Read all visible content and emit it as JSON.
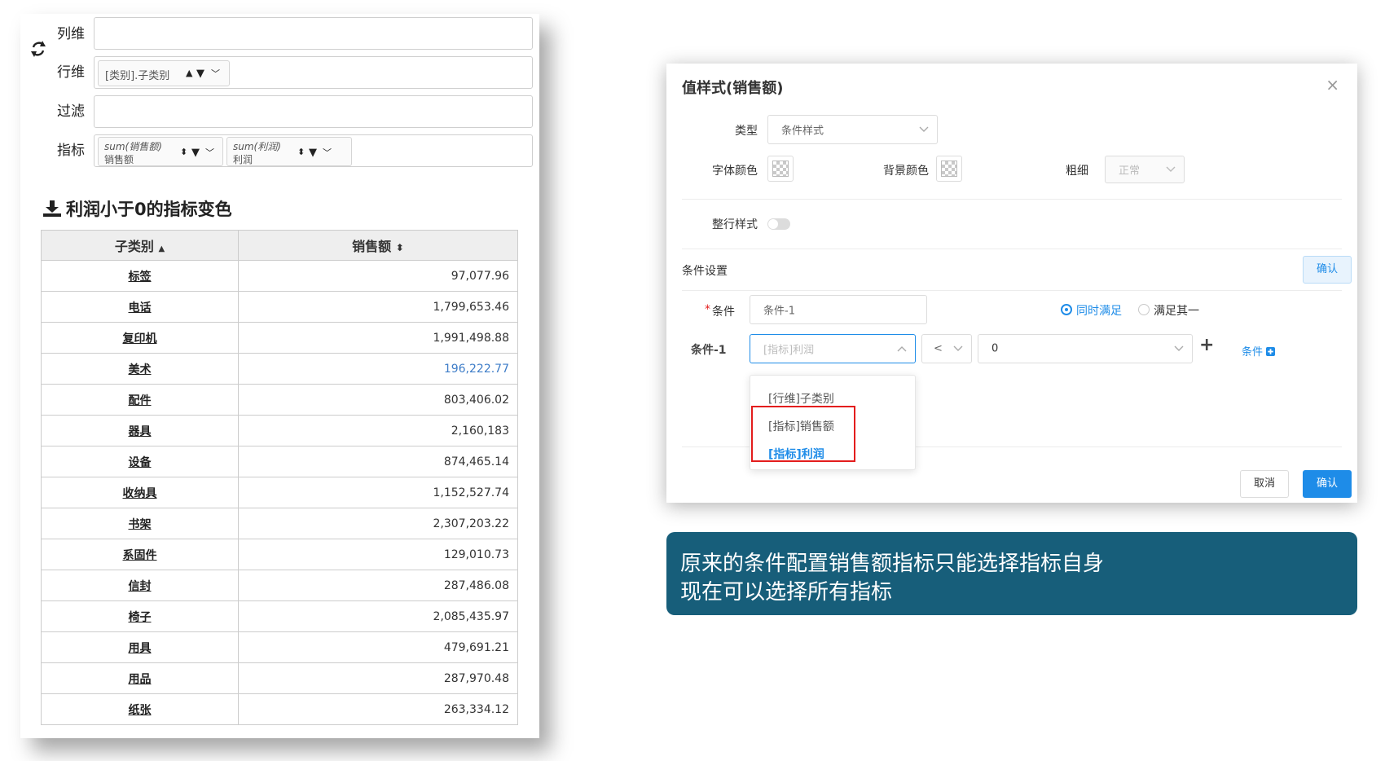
{
  "left_panel": {
    "dims": [
      {
        "label": "列维"
      },
      {
        "label": "行维",
        "tag": "[类别].子类别"
      },
      {
        "label": "过滤"
      },
      {
        "label": "指标",
        "metrics": [
          {
            "expr": "sum(销售额)",
            "name": "销售额"
          },
          {
            "expr": "sum(利润)",
            "name": "利润"
          }
        ]
      }
    ],
    "section_title": "利润小于0的指标变色",
    "table": {
      "headers": [
        "子类别",
        "销售额"
      ],
      "rows": [
        {
          "cat": "标签",
          "val": "97,077.96",
          "neg": false
        },
        {
          "cat": "电话",
          "val": "1,799,653.46",
          "neg": false
        },
        {
          "cat": "复印机",
          "val": "1,991,498.88",
          "neg": false
        },
        {
          "cat": "美术",
          "val": "196,222.77",
          "neg": true
        },
        {
          "cat": "配件",
          "val": "803,406.02",
          "neg": false
        },
        {
          "cat": "器具",
          "val": "2,160,183",
          "neg": false
        },
        {
          "cat": "设备",
          "val": "874,465.14",
          "neg": false
        },
        {
          "cat": "收纳具",
          "val": "1,152,527.74",
          "neg": false
        },
        {
          "cat": "书架",
          "val": "2,307,203.22",
          "neg": false
        },
        {
          "cat": "系固件",
          "val": "129,010.73",
          "neg": false
        },
        {
          "cat": "信封",
          "val": "287,486.08",
          "neg": false
        },
        {
          "cat": "椅子",
          "val": "2,085,435.97",
          "neg": false
        },
        {
          "cat": "用具",
          "val": "479,691.21",
          "neg": false
        },
        {
          "cat": "用品",
          "val": "287,970.48",
          "neg": false
        },
        {
          "cat": "纸张",
          "val": "263,334.12",
          "neg": false
        }
      ]
    }
  },
  "dialog": {
    "title": "值样式(销售额)",
    "close": "×",
    "type_label": "类型",
    "type_value": "条件样式",
    "font_color_label": "字体颜色",
    "bg_color_label": "背景颜色",
    "weight_label": "粗细",
    "weight_value": "正常",
    "row_style_label": "整行样式",
    "cond_settings_label": "条件设置",
    "cond_settings_confirm": "确认",
    "cond_required": "*",
    "cond_label": "条件",
    "cond_value": "条件-1",
    "radio_all": "同时满足",
    "radio_any": "满足其一",
    "cond1_label": "条件-1",
    "cond1_field_placeholder": "[指标]利润",
    "cond1_operator": "<",
    "cond1_value": "0",
    "add_plus": "+",
    "add_cond_link": "条件",
    "dropdown_options": [
      {
        "label": "[行维]子类别",
        "selected": false
      },
      {
        "label": "[指标]销售额",
        "selected": false
      },
      {
        "label": "[指标]利润",
        "selected": true
      }
    ],
    "cancel": "取消",
    "confirm": "确认"
  },
  "banner": {
    "line1": "原来的条件配置销售额指标只能选择指标自身",
    "line2": "现在可以选择所有指标"
  },
  "colors": {
    "primary": "#1e8ce8",
    "banner_bg": "#175e7a",
    "negative_value": "#3e7dc8",
    "highlight": "#e31d1d"
  }
}
